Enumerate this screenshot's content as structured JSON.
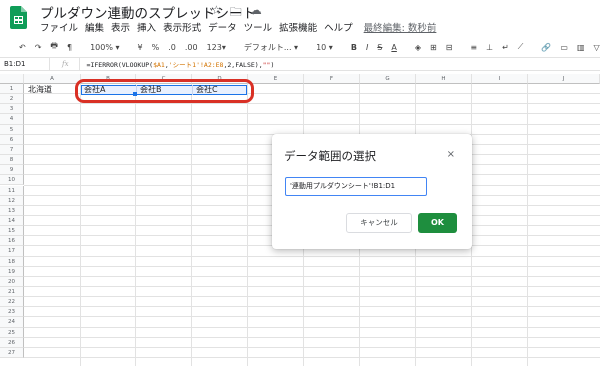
{
  "doc": {
    "title": "プルダウン連動のスプレッドシート",
    "star_icon": "☆",
    "move_icon": "🗀",
    "cloud_icon": "☁"
  },
  "menus": [
    "ファイル",
    "編集",
    "表示",
    "挿入",
    "表示形式",
    "データ",
    "ツール",
    "拡張機能",
    "ヘルプ"
  ],
  "last_edit": "最終編集: 数秒前",
  "toolbar": {
    "zoom": "100%",
    "percent": "%",
    "decimal_less": ".0",
    "decimal_more": ".00",
    "number_format": "123",
    "font": "デフォルト...",
    "font_size": "10"
  },
  "formula_bar": {
    "name_box": "B1:D1",
    "fx": "fx",
    "parts": [
      "=IFERROR(VLOOKUP(",
      "$A1",
      ",",
      "'シート1'!A2:E8",
      ",2,FALSE),",
      "\"\"",
      ")"
    ]
  },
  "columns": [
    "A",
    "B",
    "C",
    "D",
    "E",
    "F",
    "G",
    "H",
    "I",
    "J"
  ],
  "rows": [
    "1",
    "2",
    "3",
    "4",
    "5",
    "6",
    "7",
    "8",
    "9",
    "10",
    "11",
    "12",
    "13",
    "14",
    "15",
    "16",
    "17",
    "18",
    "19",
    "20",
    "21",
    "22",
    "23",
    "24",
    "25",
    "26",
    "27"
  ],
  "cells": {
    "A1": "北海道",
    "B1": "会社A",
    "C1": "会社B",
    "D1": "会社C"
  },
  "dialog": {
    "title": "データ範囲の選択",
    "close": "×",
    "range_value": "'連動用プルダウンシート'!B1:D1",
    "cancel": "キャンセル",
    "ok": "OK"
  },
  "colors": {
    "selection_fill": "#e8f0fe",
    "selection_border": "#1a73e8",
    "callout": "#d93025",
    "ok_button": "#1e8e3e",
    "sheets_green": "#0f9d58"
  }
}
